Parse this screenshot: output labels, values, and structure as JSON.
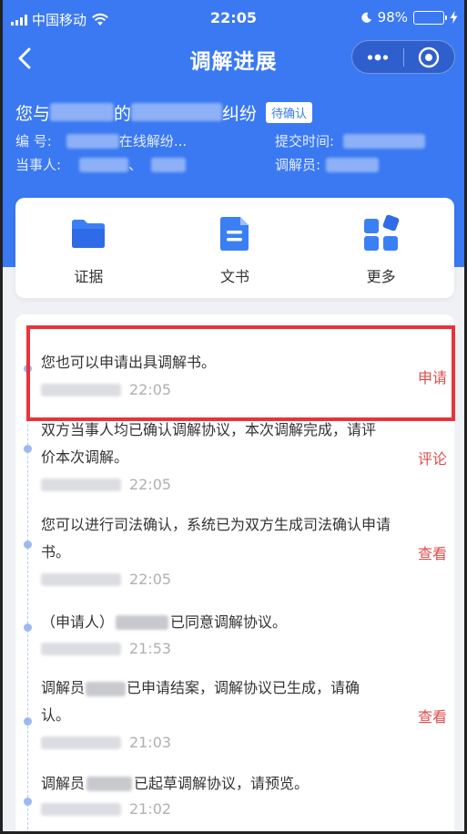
{
  "status": {
    "carrier": "中国移动",
    "time": "22:05",
    "battery": "98%"
  },
  "nav": {
    "title": "调解进展"
  },
  "dispute": {
    "prefix": "您与",
    "mid": "的",
    "suffix": "纠纷",
    "badge": "待确认",
    "number_label": "编 号:",
    "number_value": "在线解纷...",
    "submit_label": "提交时间:",
    "party_label": "当事人:",
    "party_sep": "、",
    "mediator_label": "调解员:"
  },
  "quick": {
    "evidence": "证据",
    "document": "文书",
    "more": "更多"
  },
  "timeline": [
    {
      "text": "您也可以申请出具调解书。",
      "time": "22:05",
      "action": "申请"
    },
    {
      "text": "双方当事人均已确认调解协议，本次调解完成，请评价本次调解。",
      "time": "22:05",
      "action": "评论"
    },
    {
      "text": "您可以进行司法确认，系统已为双方生成司法确认申请书。",
      "time": "22:05",
      "action": "查看"
    },
    {
      "text_prefix": "（申请人）",
      "text_suffix": "已同意调解协议。",
      "time": "21:53",
      "action": ""
    },
    {
      "text_prefix": "调解员",
      "text_suffix": "已申请结案，调解协议已生成，请确认。",
      "time": "21:03",
      "action": "查看"
    },
    {
      "text_prefix": "调解员",
      "text_suffix": "已起草调解协议，请预览。",
      "time": "21:02",
      "action": ""
    }
  ],
  "colors": {
    "brand": "#3a79f2",
    "action": "#e24c4c",
    "highlight": "#e9333a"
  }
}
